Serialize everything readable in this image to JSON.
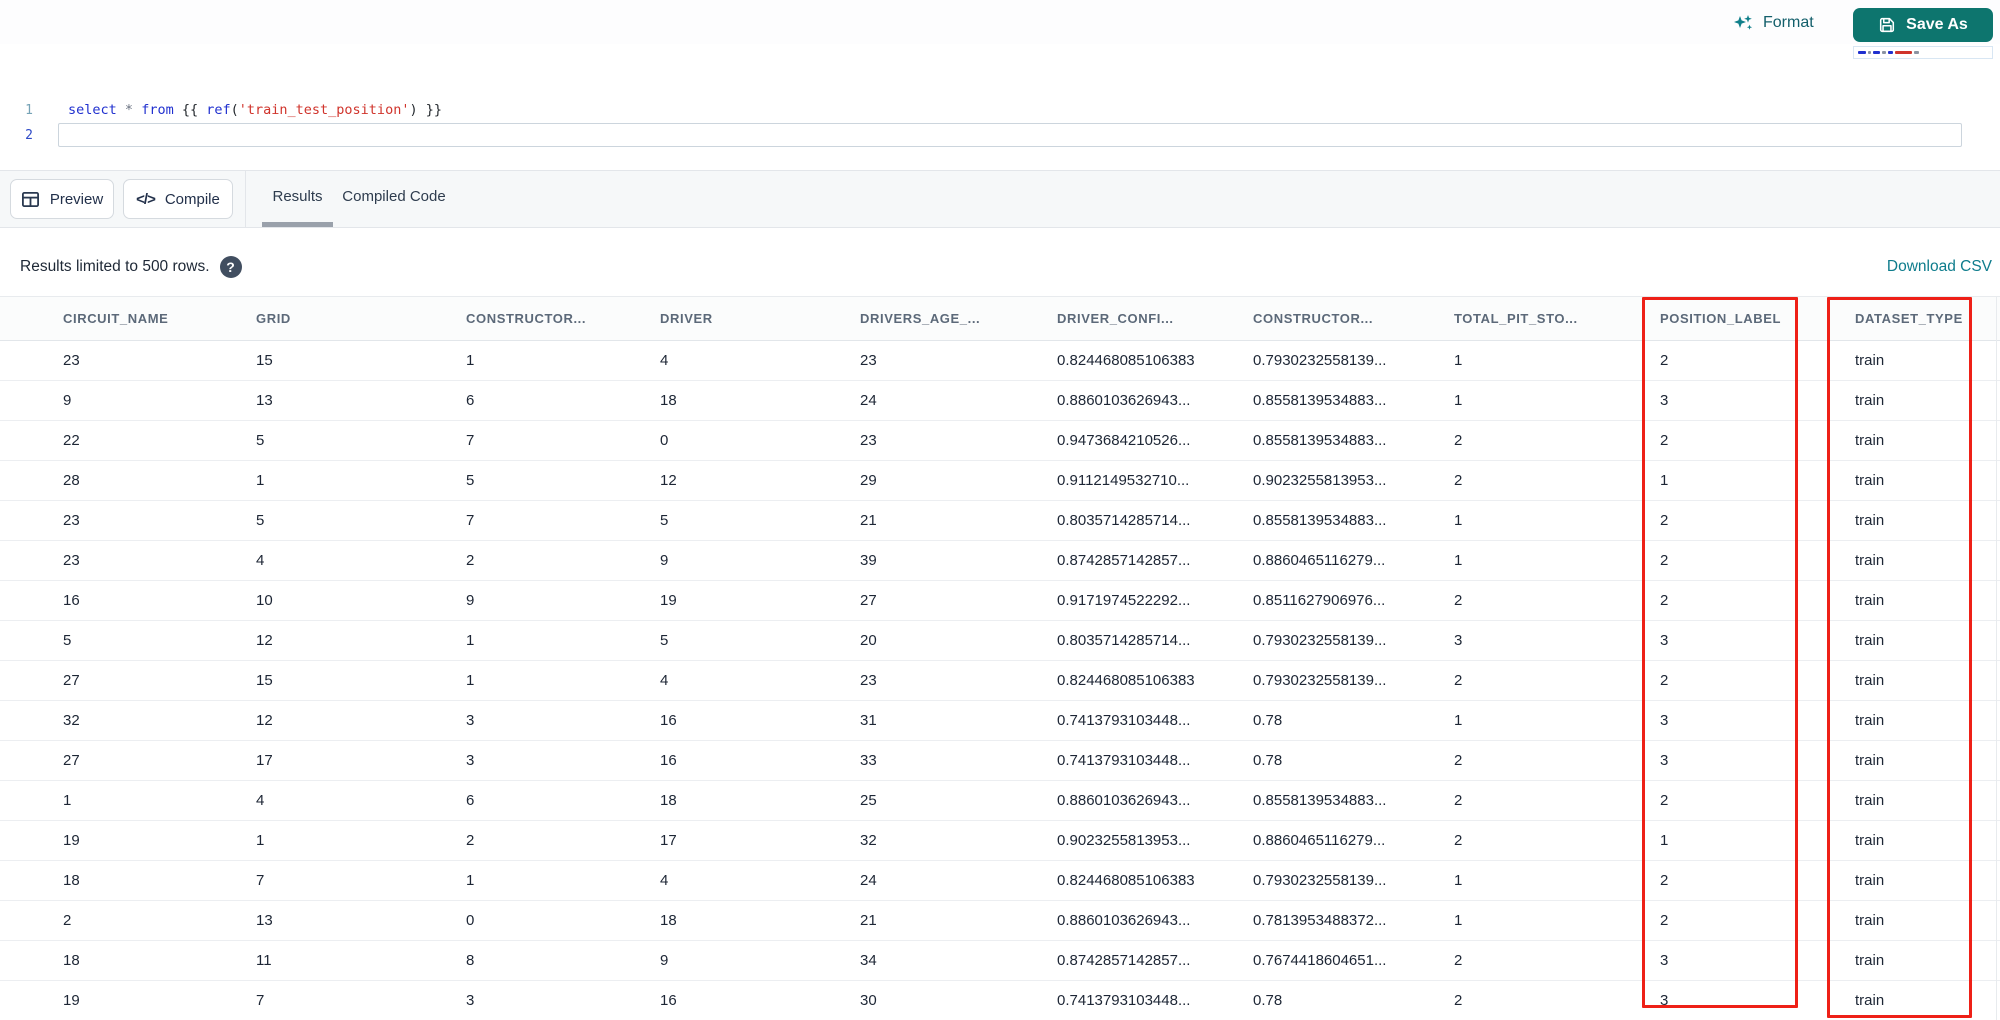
{
  "topbar": {
    "format": "Format",
    "save_as": "Save As"
  },
  "editor": {
    "line_numbers": [
      "1",
      "2"
    ],
    "code_text": "select * from {{ ref('train_test_position') }}",
    "code_tokens": [
      {
        "text": "select",
        "type": "keyword"
      },
      {
        "text": " ",
        "type": "plain"
      },
      {
        "text": "*",
        "type": "operator"
      },
      {
        "text": " ",
        "type": "plain"
      },
      {
        "text": "from",
        "type": "keyword"
      },
      {
        "text": " {{ ",
        "type": "plain"
      },
      {
        "text": "ref",
        "type": "keyword"
      },
      {
        "text": "(",
        "type": "plain"
      },
      {
        "text": "'train_test_position'",
        "type": "string"
      },
      {
        "text": ")",
        "type": "plain"
      },
      {
        "text": " }}",
        "type": "plain"
      }
    ]
  },
  "toolbar": {
    "preview": "Preview",
    "compile": "Compile",
    "tabs": [
      "Results",
      "Compiled Code"
    ],
    "active_tab": "Results"
  },
  "results_bar": {
    "limit_notice": "Results limited to 500 rows.",
    "help_glyph": "?",
    "download": "Download CSV"
  },
  "icons": {
    "format_button": "sparkles-icon",
    "save_button": "floppy-disk-icon",
    "preview_button": "table-grid-icon",
    "compile_button": "code-brackets-icon",
    "compile_glyph": "</>",
    "results_help": "question-circle-icon"
  },
  "table": {
    "columns": [
      "CIRCUIT_NAME",
      "GRID",
      "CONSTRUCTOR...",
      "DRIVER",
      "DRIVERS_AGE_...",
      "DRIVER_CONFI...",
      "CONSTRUCTOR...",
      "TOTAL_PIT_STO...",
      "POSITION_LABEL",
      "DATASET_TYPE"
    ],
    "rows": [
      [
        "23",
        "15",
        "1",
        "4",
        "23",
        "0.824468085106383",
        "0.7930232558139...",
        "1",
        "2",
        "train"
      ],
      [
        "9",
        "13",
        "6",
        "18",
        "24",
        "0.8860103626943...",
        "0.8558139534883...",
        "1",
        "3",
        "train"
      ],
      [
        "22",
        "5",
        "7",
        "0",
        "23",
        "0.9473684210526...",
        "0.8558139534883...",
        "2",
        "2",
        "train"
      ],
      [
        "28",
        "1",
        "5",
        "12",
        "29",
        "0.9112149532710...",
        "0.9023255813953...",
        "2",
        "1",
        "train"
      ],
      [
        "23",
        "5",
        "7",
        "5",
        "21",
        "0.8035714285714...",
        "0.8558139534883...",
        "1",
        "2",
        "train"
      ],
      [
        "23",
        "4",
        "2",
        "9",
        "39",
        "0.8742857142857...",
        "0.8860465116279...",
        "1",
        "2",
        "train"
      ],
      [
        "16",
        "10",
        "9",
        "19",
        "27",
        "0.9171974522292...",
        "0.8511627906976...",
        "2",
        "2",
        "train"
      ],
      [
        "5",
        "12",
        "1",
        "5",
        "20",
        "0.8035714285714...",
        "0.7930232558139...",
        "3",
        "3",
        "train"
      ],
      [
        "27",
        "15",
        "1",
        "4",
        "23",
        "0.824468085106383",
        "0.7930232558139...",
        "2",
        "2",
        "train"
      ],
      [
        "32",
        "12",
        "3",
        "16",
        "31",
        "0.7413793103448...",
        "0.78",
        "1",
        "3",
        "train"
      ],
      [
        "27",
        "17",
        "3",
        "16",
        "33",
        "0.7413793103448...",
        "0.78",
        "2",
        "3",
        "train"
      ],
      [
        "1",
        "4",
        "6",
        "18",
        "25",
        "0.8860103626943...",
        "0.8558139534883...",
        "2",
        "2",
        "train"
      ],
      [
        "19",
        "1",
        "2",
        "17",
        "32",
        "0.9023255813953...",
        "0.8860465116279...",
        "2",
        "1",
        "train"
      ],
      [
        "18",
        "7",
        "1",
        "4",
        "24",
        "0.824468085106383",
        "0.7930232558139...",
        "1",
        "2",
        "train"
      ],
      [
        "2",
        "13",
        "0",
        "18",
        "21",
        "0.8860103626943...",
        "0.7813953488372...",
        "1",
        "2",
        "train"
      ],
      [
        "18",
        "11",
        "8",
        "9",
        "34",
        "0.8742857142857...",
        "0.7674418604651...",
        "2",
        "3",
        "train"
      ],
      [
        "19",
        "7",
        "3",
        "16",
        "30",
        "0.7413793103448...",
        "0.78",
        "2",
        "3",
        "train"
      ]
    ],
    "dataset_type_value": "train"
  },
  "annotations": {
    "highlighted_columns": [
      "POSITION_LABEL",
      "DATASET_TYPE"
    ],
    "box_color": "#ee2017"
  },
  "colors": {
    "accent_teal": "#0d756e",
    "link_teal": "#0e7c8c",
    "keyword_blue": "#2030cf",
    "string_red": "#d0342c",
    "toolbar_bg": "#f6f8f9"
  }
}
